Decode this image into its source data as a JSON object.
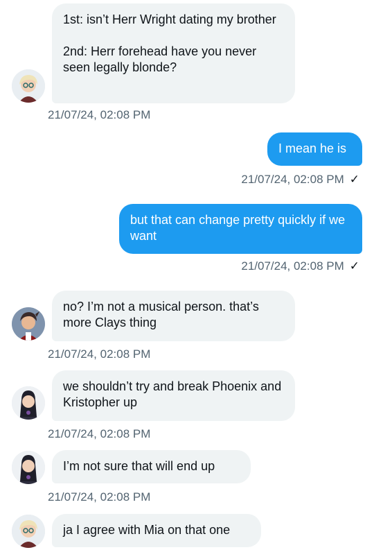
{
  "messages": [
    {
      "id": "m1",
      "side": "in",
      "text": "1st: isn’t Herr Wright dating my brother\n\n2nd: Herr forehead have you never seen legally blonde?",
      "timestamp": "21/07/24, 02:08 PM",
      "avatar": "blonde-character-avatar"
    },
    {
      "id": "m2",
      "side": "out",
      "text": "I mean he is",
      "timestamp": "21/07/24, 02:08 PM",
      "status": "✓"
    },
    {
      "id": "m3",
      "side": "out",
      "text": "but that can change pretty quickly if we want",
      "timestamp": "21/07/24, 02:08 PM",
      "status": "✓"
    },
    {
      "id": "m4",
      "side": "in",
      "text": "no? I’m not a musical person. that’s more Clays thing",
      "timestamp": "21/07/24, 02:08 PM",
      "avatar": "dark-haired-character-avatar"
    },
    {
      "id": "m5",
      "side": "in",
      "text": "we shouldn’t try and break Phoenix and Kristopher up",
      "timestamp": "21/07/24, 02:08 PM",
      "avatar": "long-haired-character-avatar"
    },
    {
      "id": "m6",
      "side": "in",
      "text": "I’m not sure that will end up",
      "timestamp": "21/07/24, 02:08 PM",
      "avatar": "long-haired-character-avatar"
    },
    {
      "id": "m7",
      "side": "in",
      "text": "ja I agree with Mia on that one",
      "timestamp": "",
      "avatar": "blonde-character-avatar"
    }
  ],
  "colors": {
    "incoming_bubble": "#eff3f4",
    "outgoing_bubble": "#1d9bf0",
    "timestamp": "#536471"
  }
}
